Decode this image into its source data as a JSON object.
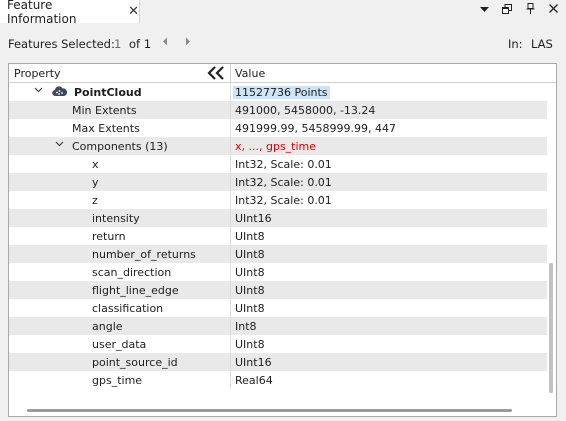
{
  "tab": {
    "title": "Feature Information",
    "close_glyph": "✕"
  },
  "window_controls": {
    "menu_icon": "dropdown-icon",
    "float_icon": "float-window-icon",
    "pin_icon": "pin-icon",
    "close_icon": "close-icon"
  },
  "selection": {
    "label": "Features Selected:",
    "current": "1",
    "of_text": "of 1",
    "in_label": "In:",
    "in_value": "LAS"
  },
  "grid": {
    "header_property": "Property",
    "header_value": "Value",
    "rows": [
      {
        "property": "PointCloud",
        "value": "11527736 Points"
      },
      {
        "property": "Min Extents",
        "value": "491000, 5458000, -13.24"
      },
      {
        "property": "Max Extents",
        "value": "491999.99, 5458999.99, 447"
      },
      {
        "property": "Components (13)",
        "value": "x, ..., gps_time"
      },
      {
        "property": "x",
        "value": "Int32, Scale: 0.01"
      },
      {
        "property": "y",
        "value": "Int32, Scale: 0.01"
      },
      {
        "property": "z",
        "value": "Int32, Scale: 0.01"
      },
      {
        "property": "intensity",
        "value": "UInt16"
      },
      {
        "property": "return",
        "value": "UInt8"
      },
      {
        "property": "number_of_returns",
        "value": "UInt8"
      },
      {
        "property": "scan_direction",
        "value": "UInt8"
      },
      {
        "property": "flight_line_edge",
        "value": "UInt8"
      },
      {
        "property": "classification",
        "value": "UInt8"
      },
      {
        "property": "angle",
        "value": "Int8"
      },
      {
        "property": "user_data",
        "value": "UInt8"
      },
      {
        "property": "point_source_id",
        "value": "UInt16"
      },
      {
        "property": "gps_time",
        "value": "Real64"
      }
    ]
  },
  "colors": {
    "highlight": "#cce4f7",
    "components_value": "#e00000",
    "alt_row": "#e9e9e9"
  }
}
